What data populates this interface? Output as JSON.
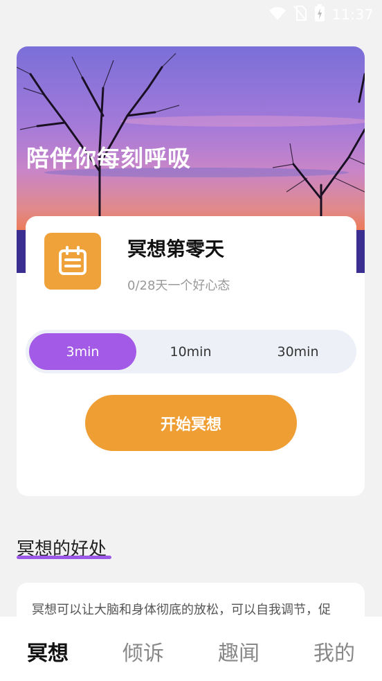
{
  "status_bar": {
    "time": "11:37",
    "icons": [
      "wifi-icon",
      "no-sim-icon",
      "battery-charging-icon"
    ]
  },
  "banner": {
    "title": "陪伴你每刻呼吸"
  },
  "meditation_info": {
    "icon": "calendar-icon",
    "title": "冥想第零天",
    "subtitle": "0/28天一个好心态"
  },
  "duration_options": [
    {
      "label": "3min",
      "selected": true
    },
    {
      "label": "10min",
      "selected": false
    },
    {
      "label": "30min",
      "selected": false
    }
  ],
  "start_button": {
    "label": "开始冥想"
  },
  "benefits": {
    "title": "冥想的好处",
    "text": "冥想可以让大脑和身体彻底的放松，可以自我调节，促"
  },
  "bottom_nav": [
    {
      "label": "冥想",
      "active": true
    },
    {
      "label": "倾诉",
      "active": false
    },
    {
      "label": "趣闻",
      "active": false
    },
    {
      "label": "我的",
      "active": false
    }
  ],
  "colors": {
    "accent_purple": "#a35ae6",
    "accent_orange": "#ef9e33",
    "background": "#f2f2f2"
  }
}
